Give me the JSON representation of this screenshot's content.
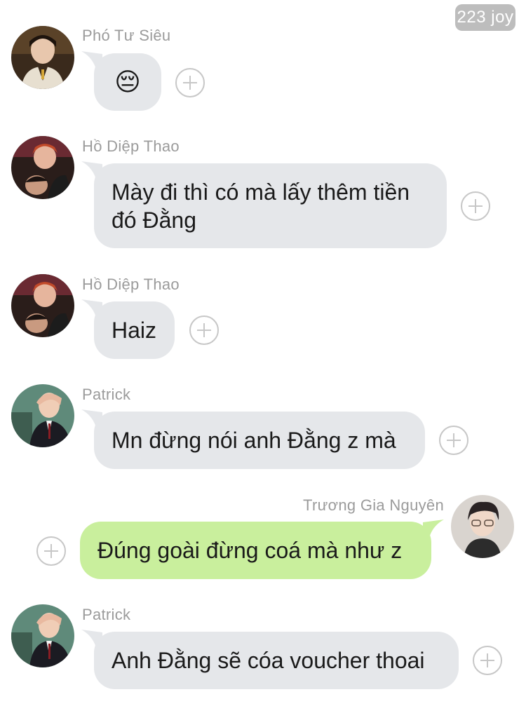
{
  "watermark": "223 joy",
  "messages": [
    {
      "sender": "Phó Tư Siêu",
      "text": "😔",
      "avatar": "sieu-avatar",
      "side": "left"
    },
    {
      "sender": "Hồ Diệp Thao",
      "text": "Mày đi thì có mà lấy thêm tiền\nđó Đằng",
      "avatar": "thao-avatar",
      "side": "left"
    },
    {
      "sender": "Hồ Diệp Thao",
      "text": "Haiz",
      "avatar": "thao-avatar",
      "side": "left"
    },
    {
      "sender": "Patrick",
      "text": "Mn đừng nói anh Đằng z mà",
      "avatar": "patrick-avatar",
      "side": "left"
    },
    {
      "sender": "Trương Gia Nguyên",
      "text": "Đúng goài đừng coá mà như z",
      "avatar": "nguyen-avatar",
      "side": "right"
    },
    {
      "sender": "Patrick",
      "text": "Anh Đằng sẽ cóa voucher thoai",
      "avatar": "patrick-avatar",
      "side": "left"
    }
  ],
  "colors": {
    "incoming_bubble": "#e5e7ea",
    "outgoing_bubble": "#c9ef9d",
    "sender_name": "#9b9b9b",
    "watermark_bg": "#bdbdbd"
  },
  "icons": {
    "reaction": "plus-circle-icon"
  }
}
